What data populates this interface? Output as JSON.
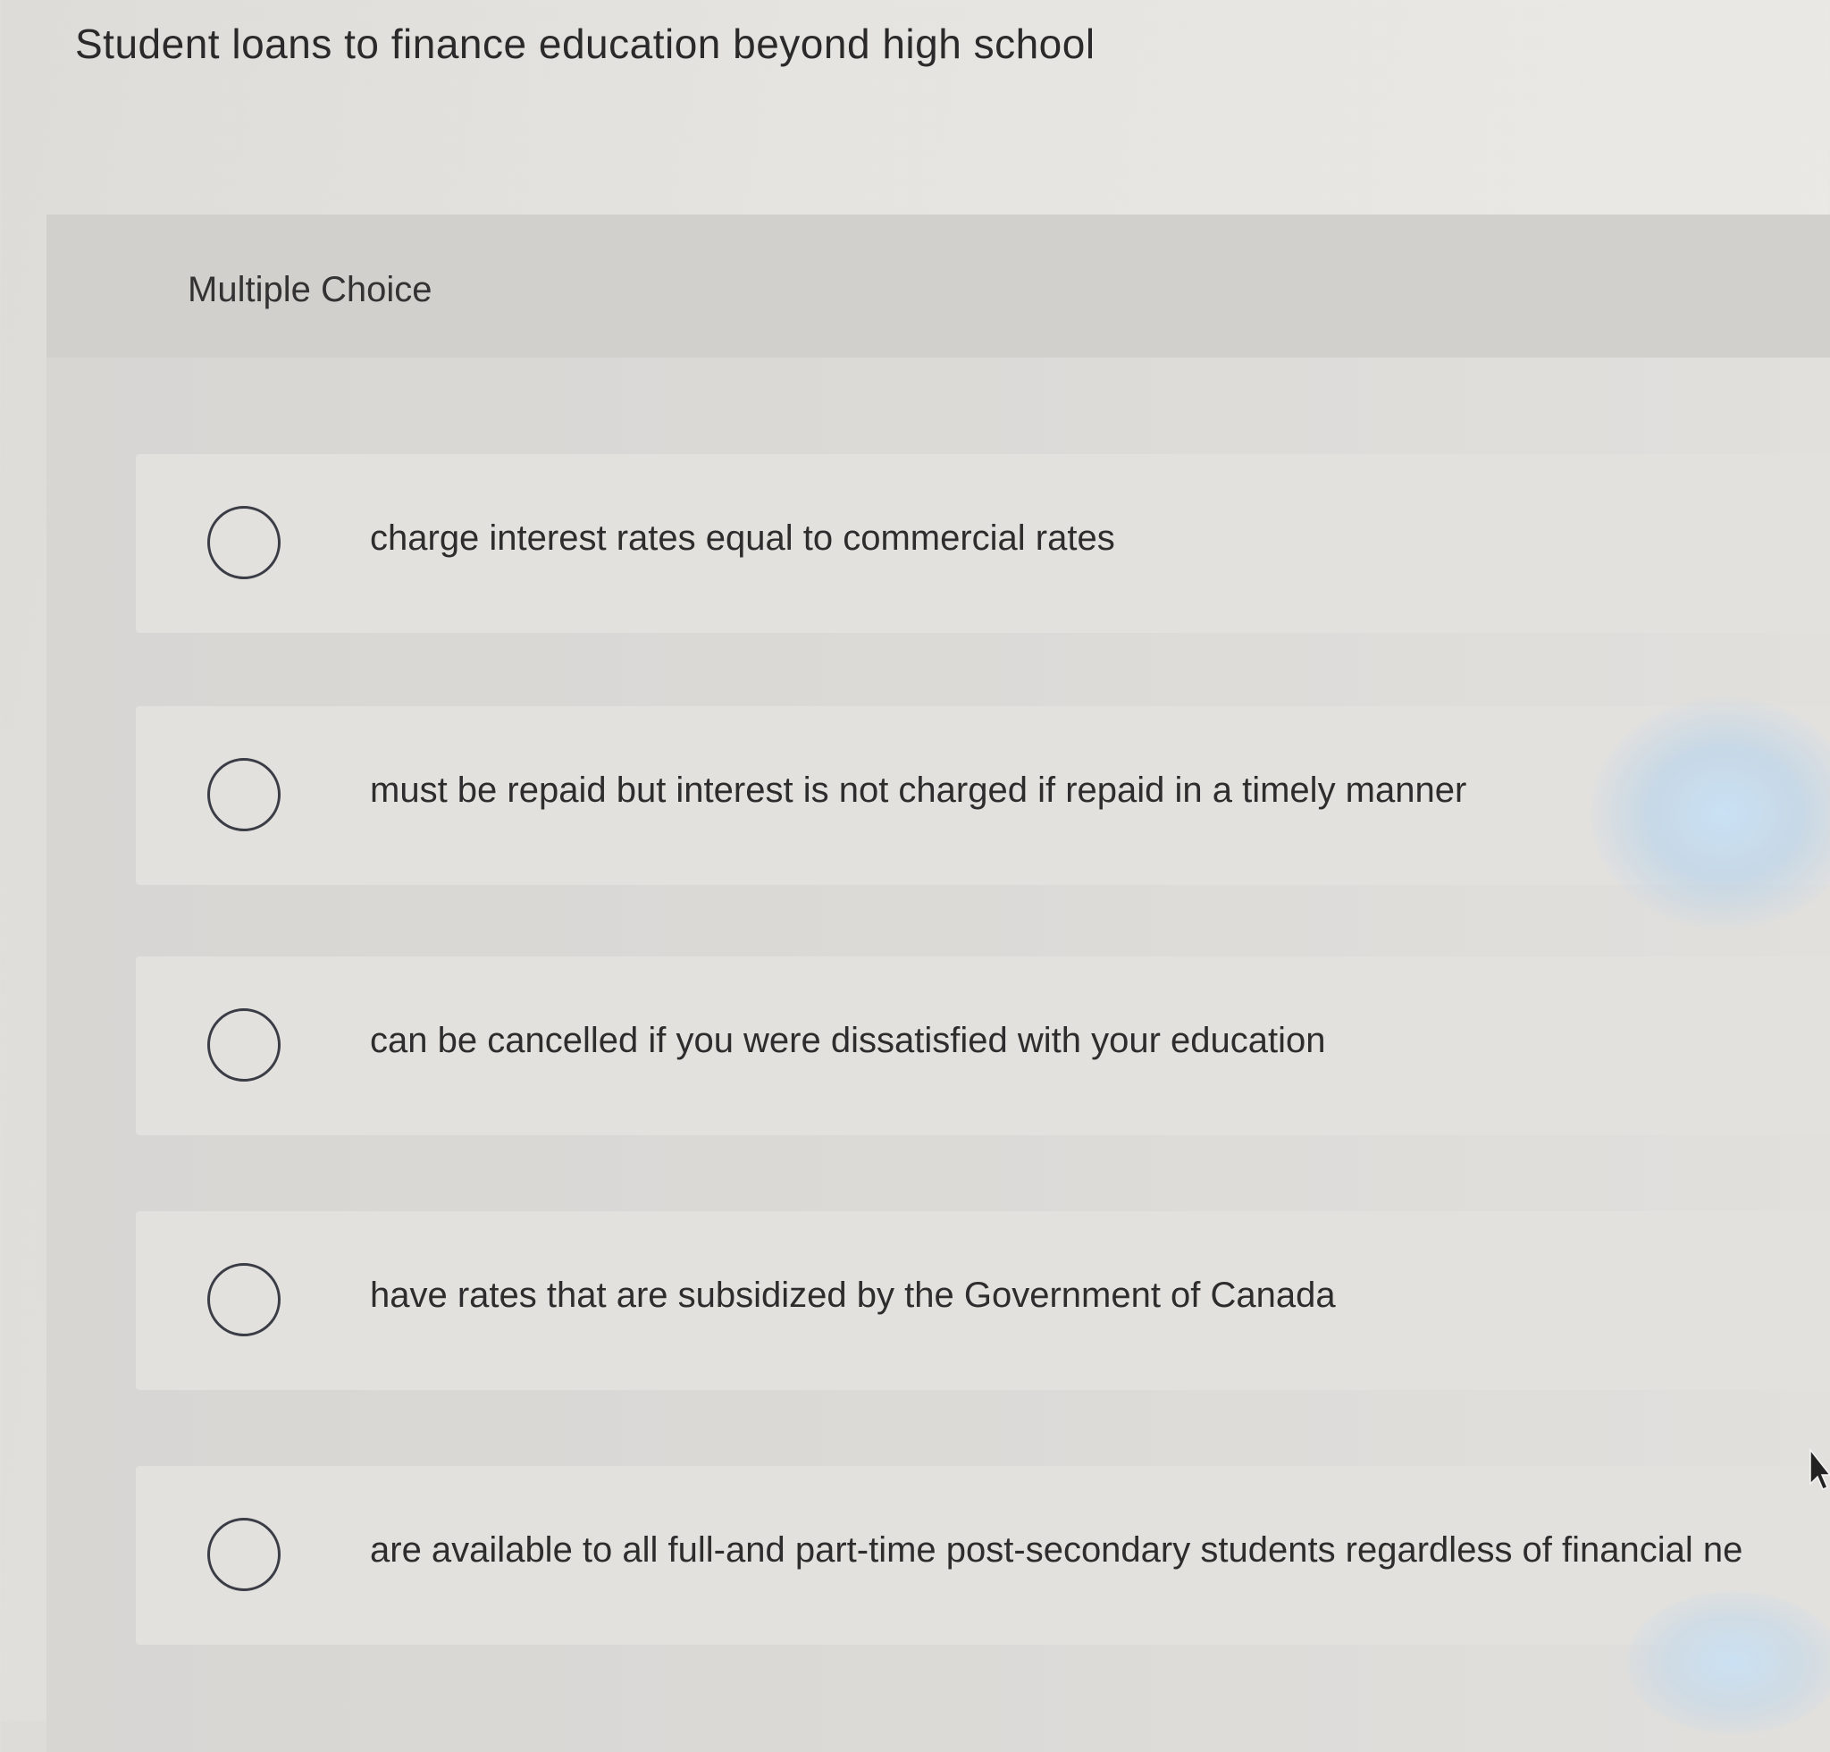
{
  "question": {
    "stem": "Student loans to finance education beyond high school",
    "type_label": "Multiple Choice"
  },
  "choices": [
    {
      "label": "charge interest rates equal to commercial rates",
      "selected": false
    },
    {
      "label": "must be repaid but interest is not charged if repaid in a timely manner",
      "selected": false
    },
    {
      "label": "can be cancelled if you were dissatisfied with your education",
      "selected": false
    },
    {
      "label": "have rates that are subsidized by the Government of Canada",
      "selected": false
    },
    {
      "label": "are available to all full-and part-time post-secondary students regardless of financial ne",
      "selected": false
    }
  ],
  "icons": {
    "radio": "radio-unchecked-icon",
    "cursor": "mouse-pointer-icon"
  },
  "colors": {
    "radio_border": "#3b3d46",
    "text": "#2d2d2d",
    "panel": "#d8d6d3",
    "choice_bg": "#e3e1de"
  }
}
